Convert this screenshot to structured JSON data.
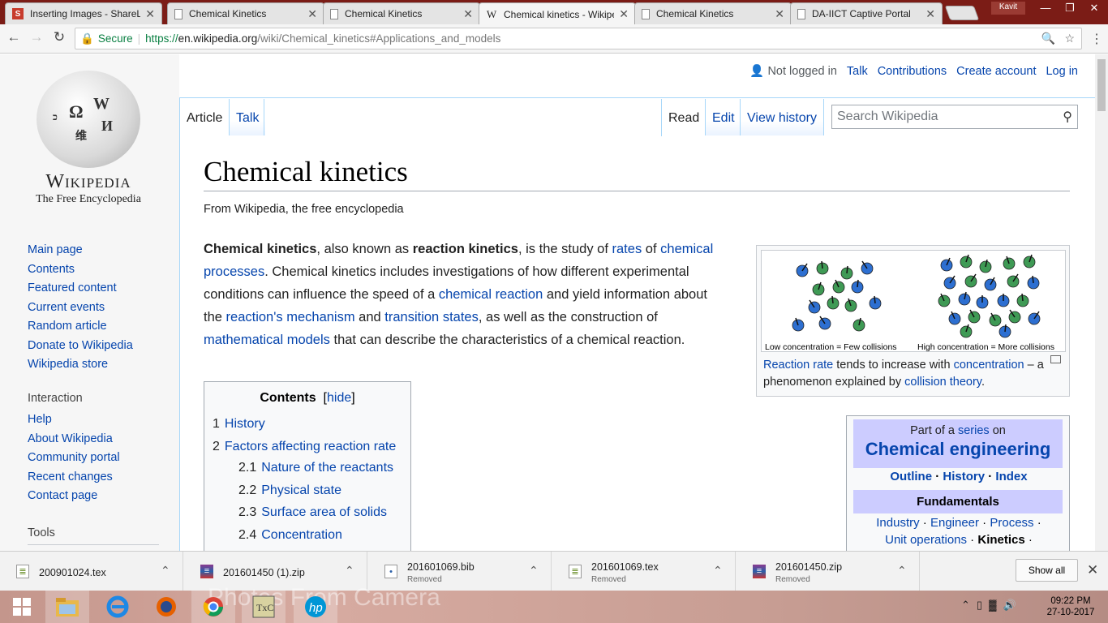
{
  "browser": {
    "tabs": [
      {
        "title": "Inserting Images - ShareLaTeX",
        "icon": "sharelatex-icon"
      },
      {
        "title": "Chemical Kinetics",
        "icon": "document-icon"
      },
      {
        "title": "Chemical Kinetics",
        "icon": "document-icon"
      },
      {
        "title": "Chemical kinetics - Wikipedia",
        "icon": "wikipedia-w-icon"
      },
      {
        "title": "Chemical Kinetics",
        "icon": "document-icon"
      },
      {
        "title": "DA-IICT Captive Portal",
        "icon": "document-icon"
      }
    ],
    "user": "Kavit",
    "address": {
      "secure_label": "Secure",
      "scheme": "https://",
      "host": "en.wikipedia.org",
      "path": "/wiki/Chemical_kinetics#Applications_and_models"
    }
  },
  "wiki": {
    "logo": {
      "wordmark": "Wikipedia",
      "tagline": "The Free Encyclopedia"
    },
    "nav": [
      "Main page",
      "Contents",
      "Featured content",
      "Current events",
      "Random article",
      "Donate to Wikipedia",
      "Wikipedia store"
    ],
    "interaction": {
      "heading": "Interaction",
      "items": [
        "Help",
        "About Wikipedia",
        "Community portal",
        "Recent changes",
        "Contact page"
      ]
    },
    "tools_heading": "Tools",
    "personal": {
      "not_logged_in": "Not logged in",
      "talk": "Talk",
      "contributions": "Contributions",
      "create_account": "Create account",
      "log_in": "Log in"
    },
    "tabs": {
      "article": "Article",
      "talk": "Talk",
      "read": "Read",
      "edit": "Edit",
      "history": "View history"
    },
    "search_placeholder": "Search Wikipedia",
    "title": "Chemical kinetics",
    "site_sub": "From Wikipedia, the free encyclopedia",
    "lead": [
      {
        "t": "Chemical kinetics",
        "s": "b"
      },
      {
        "t": ", also known as "
      },
      {
        "t": "reaction kinetics",
        "s": "b"
      },
      {
        "t": ", is the study of "
      },
      {
        "t": "rates",
        "s": "a"
      },
      {
        "t": " of "
      },
      {
        "t": "chemical processes",
        "s": "a"
      },
      {
        "t": ". Chemical kinetics includes investigations of how different experimental conditions can influence the speed of a "
      },
      {
        "t": "chemical reaction",
        "s": "a"
      },
      {
        "t": " and yield information about the "
      },
      {
        "t": "reaction's mechanism",
        "s": "a"
      },
      {
        "t": " and "
      },
      {
        "t": "transition states",
        "s": "a"
      },
      {
        "t": ", as well as the construction of "
      },
      {
        "t": "mathematical models",
        "s": "a"
      },
      {
        "t": " that can describe the characteristics of a chemical reaction."
      }
    ],
    "toc": {
      "title": "Contents",
      "hide": "hide",
      "items": [
        {
          "num": "1",
          "label": "History"
        },
        {
          "num": "2",
          "label": "Factors affecting reaction rate"
        },
        {
          "num": "2.1",
          "label": "Nature of the reactants"
        },
        {
          "num": "2.2",
          "label": "Physical state"
        },
        {
          "num": "2.3",
          "label": "Surface area of solids"
        },
        {
          "num": "2.4",
          "label": "Concentration"
        }
      ]
    },
    "figure": {
      "label_low": "Low concentration = Few collisions",
      "label_high": "High concentration = More collisions",
      "caption": [
        {
          "t": "Reaction rate",
          "s": "a"
        },
        {
          "t": " tends to increase with "
        },
        {
          "t": "concentration",
          "s": "a"
        },
        {
          "t": " – a phenomenon explained by "
        },
        {
          "t": "collision theory",
          "s": "a"
        },
        {
          "t": "."
        }
      ]
    },
    "series": {
      "part_of": "Part of a",
      "series_link": "series",
      "on": "on",
      "topic": "Chemical engineering",
      "links": [
        "Outline",
        "History",
        "Index"
      ],
      "fundamentals_heading": "Fundamentals",
      "fund_row1": [
        "Industry",
        "Engineer",
        "Process"
      ],
      "fund_row2_links": [
        "Unit operations"
      ],
      "fund_row2_current": "Kinetics"
    }
  },
  "downloads": [
    {
      "name": "200901024.tex",
      "status": "",
      "icon": "tex-file-icon"
    },
    {
      "name": "201601450 (1).zip",
      "status": "",
      "icon": "zip-file-icon"
    },
    {
      "name": "201601069.bib",
      "status": "Removed",
      "icon": "bib-file-icon"
    },
    {
      "name": "201601069.tex",
      "status": "Removed",
      "icon": "tex-file-icon"
    },
    {
      "name": "201601450.zip",
      "status": "Removed",
      "icon": "zip-file-icon"
    }
  ],
  "show_all": "Show all",
  "taskbar": {
    "time": "09:22 PM",
    "date": "27-10-2017",
    "overlay_text": "Photos From Camera",
    "apps": [
      "windows-start-icon",
      "file-explorer-icon",
      "internet-explorer-icon",
      "firefox-icon",
      "chrome-icon",
      "texmaker-icon",
      "hp-icon"
    ]
  },
  "colors": {
    "link": "#0645ad",
    "series_header": "#ccccff",
    "titlebar": "#7b1c16"
  }
}
